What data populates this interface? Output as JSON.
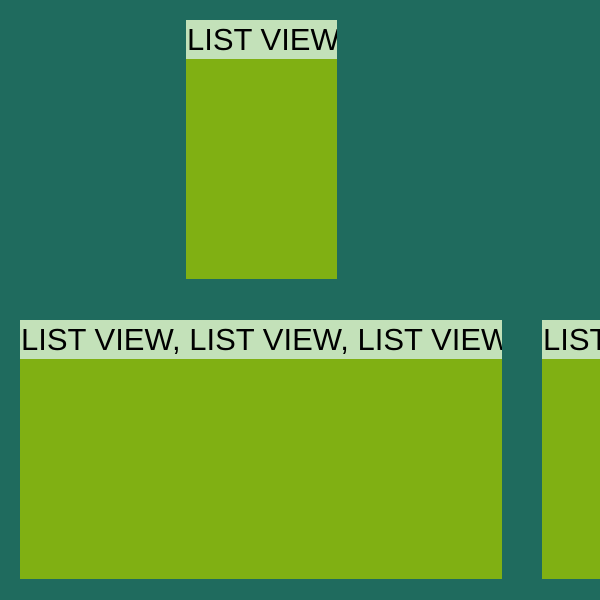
{
  "colors": {
    "background": "#1f6b5e",
    "panel_body": "#80b013",
    "panel_header": "#c3e1b9",
    "header_text": "#000000"
  },
  "panels": [
    {
      "title": "LIST VIEW"
    },
    {
      "title": "LIST VIEW, LIST VIEW, LIST VIEW"
    },
    {
      "title": "LIST VIEW"
    }
  ]
}
